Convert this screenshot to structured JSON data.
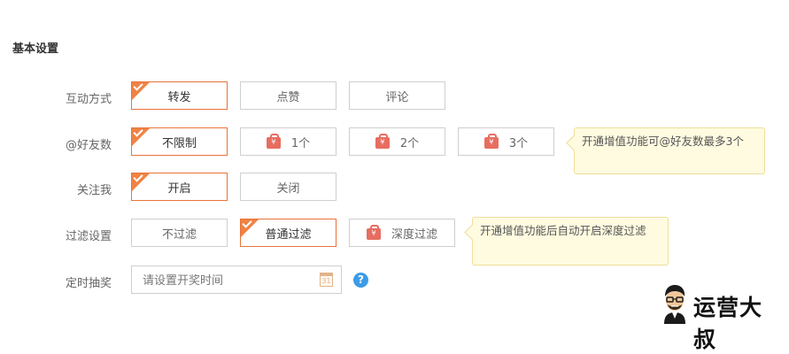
{
  "section_title": "基本设置",
  "interaction": {
    "label": "互动方式",
    "options": [
      "转发",
      "点赞",
      "评论"
    ]
  },
  "friends": {
    "label": "@好友数",
    "options": [
      "不限制",
      "1个",
      "2个",
      "3个"
    ],
    "premium_icon": "red-bag-icon",
    "premium_symbol": "¥",
    "tip": "开通增值功能可@好友数最多3个"
  },
  "follow": {
    "label": "关注我",
    "options": [
      "开启",
      "关闭"
    ]
  },
  "filter": {
    "label": "过滤设置",
    "options": [
      "不过滤",
      "普通过滤",
      "深度过滤"
    ],
    "tip": "开通增值功能后自动开启深度过滤"
  },
  "timer": {
    "label": "定时抽奖",
    "placeholder": "请设置开奖时间",
    "calendar_number": "31",
    "help_symbol": "?"
  },
  "brand": {
    "text": "运营大叔"
  },
  "colors": {
    "accent": "#f08344",
    "selected_border": "#e8733b",
    "premium": "#e76d61",
    "tip_bg": "#fffbe0",
    "help": "#3d9be6"
  }
}
